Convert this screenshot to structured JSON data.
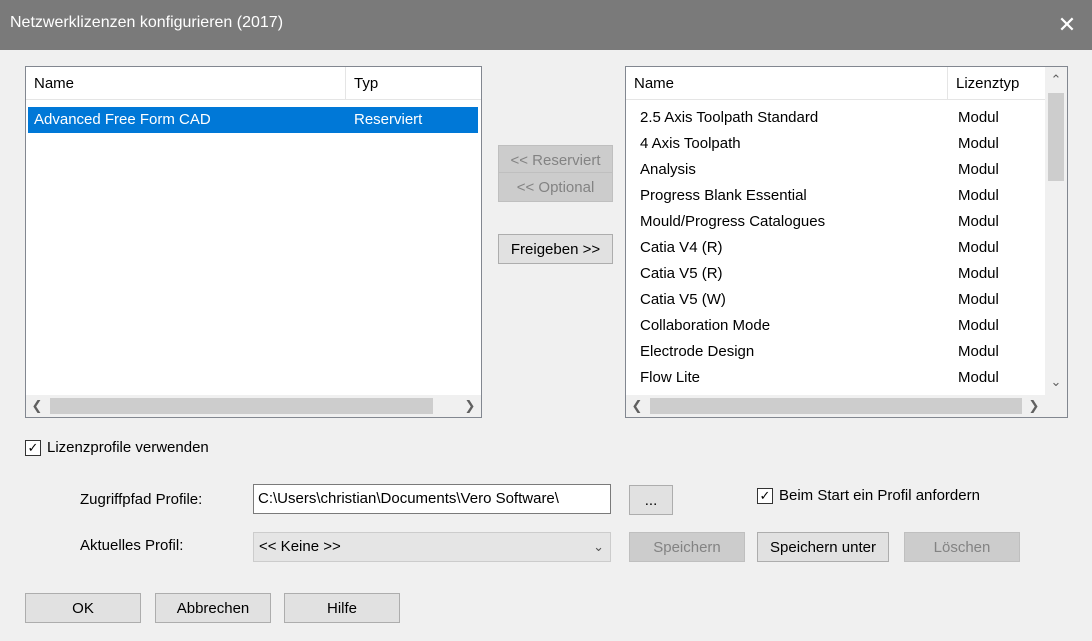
{
  "window": {
    "title": "Netzwerklizenzen konfigurieren (2017)",
    "close_icon": "close-icon"
  },
  "left_list": {
    "columns": [
      "Name",
      "Typ"
    ],
    "rows": [
      {
        "name": "Advanced Free Form CAD",
        "type": "Reserviert",
        "selected": true
      }
    ]
  },
  "middle_buttons": {
    "reserve": "<< Reserviert",
    "optional": "<< Optional",
    "release": "Freigeben >>"
  },
  "right_list": {
    "columns": [
      "Name",
      "Lizenztyp"
    ],
    "rows": [
      {
        "name": "2.5 Axis Toolpath Standard",
        "type": "Modul"
      },
      {
        "name": "4 Axis Toolpath",
        "type": "Modul"
      },
      {
        "name": "Analysis",
        "type": "Modul"
      },
      {
        "name": "Progress Blank Essential",
        "type": "Modul"
      },
      {
        "name": "Mould/Progress Catalogues",
        "type": "Modul"
      },
      {
        "name": "Catia V4 (R)",
        "type": "Modul"
      },
      {
        "name": "Catia V5 (R)",
        "type": "Modul"
      },
      {
        "name": "Catia V5 (W)",
        "type": "Modul"
      },
      {
        "name": "Collaboration Mode",
        "type": "Modul"
      },
      {
        "name": "Electrode Design",
        "type": "Modul"
      },
      {
        "name": "Flow Lite",
        "type": "Modul"
      }
    ]
  },
  "license_profiles": {
    "use_label": "Lizenzprofile verwenden",
    "use_checked": true,
    "path_label": "Zugriffpfad Profile:",
    "path_value": "C:\\Users\\christian\\Documents\\Vero Software\\",
    "browse_label": "...",
    "request_label": "Beim Start ein Profil anfordern",
    "request_checked": true,
    "current_label": "Aktuelles Profil:",
    "current_value": "<< Keine >>",
    "save_label": "Speichern",
    "save_as_label": "Speichern unter",
    "delete_label": "Löschen"
  },
  "footer": {
    "ok": "OK",
    "cancel": "Abbrechen",
    "help": "Hilfe"
  }
}
